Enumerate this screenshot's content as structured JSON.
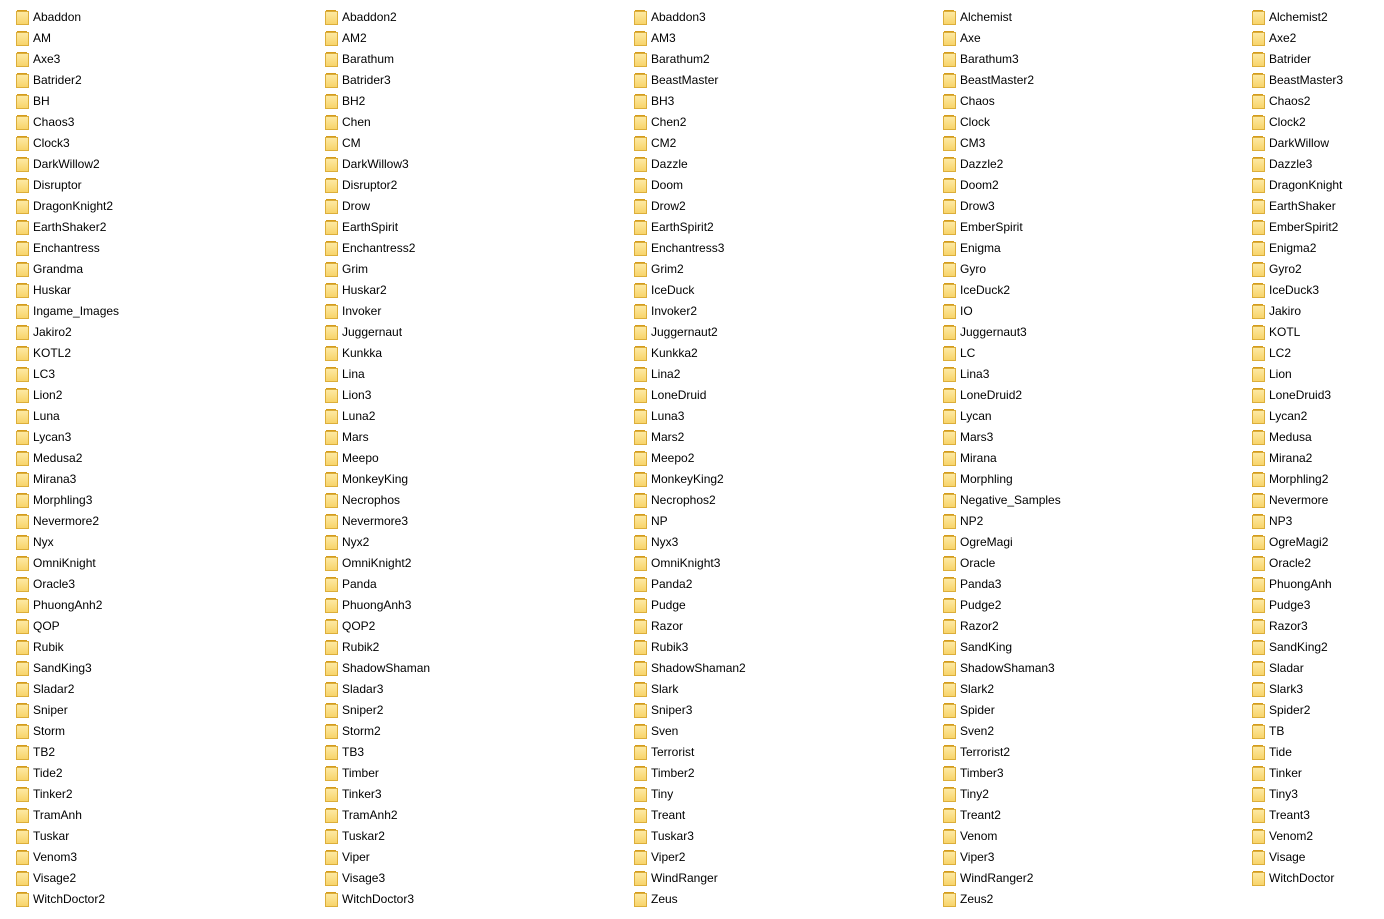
{
  "folders": [
    "Abaddon",
    "Abaddon2",
    "Abaddon3",
    "Alchemist",
    "Alchemist2",
    "AM",
    "AM2",
    "AM3",
    "Axe",
    "Axe2",
    "Axe3",
    "Barathum",
    "Barathum2",
    "Barathum3",
    "Batrider",
    "Batrider2",
    "Batrider3",
    "BeastMaster",
    "BeastMaster2",
    "BeastMaster3",
    "BH",
    "BH2",
    "BH3",
    "Chaos",
    "Chaos2",
    "Chaos3",
    "Chen",
    "Chen2",
    "Clock",
    "Clock2",
    "Clock3",
    "CM",
    "CM2",
    "CM3",
    "DarkWillow",
    "DarkWillow2",
    "DarkWillow3",
    "Dazzle",
    "Dazzle2",
    "Dazzle3",
    "Disruptor",
    "Disruptor2",
    "Doom",
    "Doom2",
    "DragonKnight",
    "DragonKnight2",
    "Drow",
    "Drow2",
    "Drow3",
    "EarthShaker",
    "EarthShaker2",
    "EarthSpirit",
    "EarthSpirit2",
    "EmberSpirit",
    "EmberSpirit2",
    "Enchantress",
    "Enchantress2",
    "Enchantress3",
    "Enigma",
    "Enigma2",
    "Grandma",
    "Grim",
    "Grim2",
    "Gyro",
    "Gyro2",
    "Huskar",
    "Huskar2",
    "IceDuck",
    "IceDuck2",
    "IceDuck3",
    "Ingame_Images",
    "Invoker",
    "Invoker2",
    "IO",
    "Jakiro",
    "Jakiro2",
    "Juggernaut",
    "Juggernaut2",
    "Juggernaut3",
    "KOTL",
    "KOTL2",
    "Kunkka",
    "Kunkka2",
    "LC",
    "LC2",
    "LC3",
    "Lina",
    "Lina2",
    "Lina3",
    "Lion",
    "Lion2",
    "Lion3",
    "LoneDruid",
    "LoneDruid2",
    "LoneDruid3",
    "Luna",
    "Luna2",
    "Luna3",
    "Lycan",
    "Lycan2",
    "Lycan3",
    "Mars",
    "Mars2",
    "Mars3",
    "Medusa",
    "Medusa2",
    "Meepo",
    "Meepo2",
    "Mirana",
    "Mirana2",
    "Mirana3",
    "MonkeyKing",
    "MonkeyKing2",
    "Morphling",
    "Morphling2",
    "Morphling3",
    "Necrophos",
    "Necrophos2",
    "Negative_Samples",
    "Nevermore",
    "Nevermore2",
    "Nevermore3",
    "NP",
    "NP2",
    "NP3",
    "Nyx",
    "Nyx2",
    "Nyx3",
    "OgreMagi",
    "OgreMagi2",
    "OmniKnight",
    "OmniKnight2",
    "OmniKnight3",
    "Oracle",
    "Oracle2",
    "Oracle3",
    "Panda",
    "Panda2",
    "Panda3",
    "PhuongAnh",
    "PhuongAnh2",
    "PhuongAnh3",
    "Pudge",
    "Pudge2",
    "Pudge3",
    "QOP",
    "QOP2",
    "Razor",
    "Razor2",
    "Razor3",
    "Rubik",
    "Rubik2",
    "Rubik3",
    "SandKing",
    "SandKing2",
    "SandKing3",
    "ShadowShaman",
    "ShadowShaman2",
    "ShadowShaman3",
    "Sladar",
    "Sladar2",
    "Sladar3",
    "Slark",
    "Slark2",
    "Slark3",
    "Sniper",
    "Sniper2",
    "Sniper3",
    "Spider",
    "Spider2",
    "Storm",
    "Storm2",
    "Sven",
    "Sven2",
    "TB",
    "TB2",
    "TB3",
    "Terrorist",
    "Terrorist2",
    "Tide",
    "Tide2",
    "Timber",
    "Timber2",
    "Timber3",
    "Tinker",
    "Tinker2",
    "Tinker3",
    "Tiny",
    "Tiny2",
    "Tiny3",
    "TramAnh",
    "TramAnh2",
    "Treant",
    "Treant2",
    "Treant3",
    "Tuskar",
    "Tuskar2",
    "Tuskar3",
    "Venom",
    "Venom2",
    "Venom3",
    "Viper",
    "Viper2",
    "Viper3",
    "Visage",
    "Visage2",
    "Visage3",
    "WindRanger",
    "WindRanger2",
    "WitchDoctor",
    "WitchDoctor2",
    "WitchDoctor3",
    "Zeus",
    "Zeus2"
  ],
  "icon": "folder-icon",
  "colors": {
    "folder_fill": "#f8d46a",
    "folder_border": "#dcae3a",
    "background": "#ffffff",
    "text": "#000000"
  }
}
